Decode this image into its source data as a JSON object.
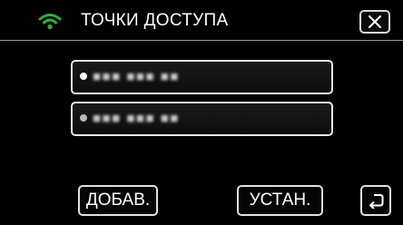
{
  "header": {
    "title": "ТОЧКИ ДОСТУПА",
    "wifi_icon": "wifi-icon",
    "close_icon": "close-icon"
  },
  "access_points": [
    {
      "name": "■■■ ■■■ ■■"
    },
    {
      "name": "■■■ ■■■ ■■"
    }
  ],
  "footer": {
    "add_label": "ДОБАВ.",
    "set_label": "УСТАН.",
    "back_icon": "return-icon"
  },
  "colors": {
    "background": "#000000",
    "text": "#ffffff",
    "wifi": "#2fae3a",
    "border": "#e0e0e0"
  }
}
